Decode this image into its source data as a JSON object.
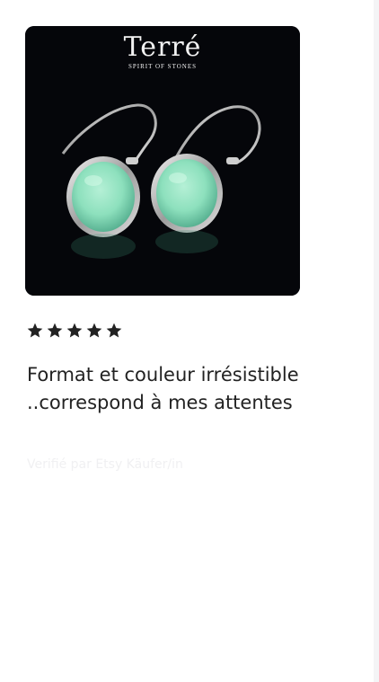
{
  "product_image": {
    "brand_name": "Terré",
    "brand_tagline": "SPIRIT OF STONES",
    "stone_color": "#8de0bd",
    "background_color": "#05060a"
  },
  "rating": {
    "stars_filled": 5,
    "stars_total": 5,
    "star_color": "#222222"
  },
  "review": {
    "text": "Format et couleur irrésistible ..correspond à mes attentes"
  },
  "reviewer": {
    "prefix": "Verifié par",
    "name": "Etsy Käufer/in"
  }
}
